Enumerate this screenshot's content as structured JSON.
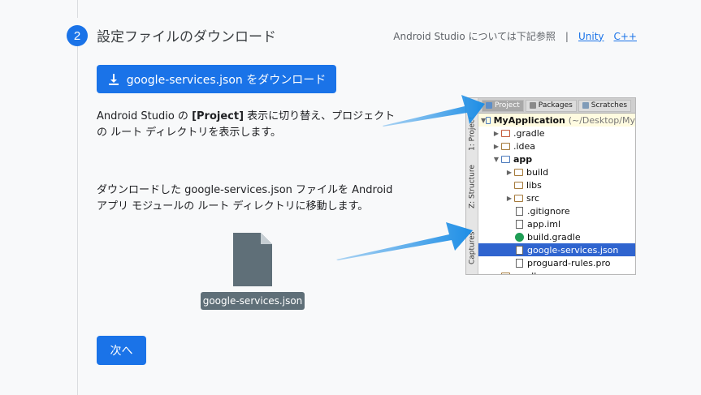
{
  "step": {
    "number": "2",
    "title": "設定ファイルのダウンロード"
  },
  "header_links": {
    "intro_text": "Android Studio については下記参照",
    "separator": "|",
    "unity_label": "Unity",
    "cpp_label": "C++"
  },
  "download_button": {
    "label": "google-services.json をダウンロード",
    "icon": "download-icon"
  },
  "instructions": {
    "first_prefix": "Android Studio の ",
    "first_bold": "[Project]",
    "first_suffix": " 表示に切り替え、プロジェクトの ルート ディレクトリを表示します。",
    "second": "ダウンロードした google-services.json ファイルを Android アプリ モジュールの ルート ディレクトリに移動します。"
  },
  "file_card": {
    "label": "google-services.json",
    "icon": "file-icon",
    "color": "#5f6f78"
  },
  "next_button": {
    "label": "次へ"
  },
  "ide_panel": {
    "side_tabs": [
      "1: Project",
      "Z: Structure",
      "Captures"
    ],
    "tabs": [
      "Project",
      "Packages",
      "Scratches"
    ],
    "root_name": "MyApplication",
    "root_path": "(~/Desktop/My",
    "rows": [
      ".gradle",
      ".idea",
      "app",
      "build",
      "libs",
      "src",
      ".gitignore",
      "app.iml",
      "build.gradle",
      "google-services.json",
      "proguard-rules.pro",
      "gradle"
    ]
  },
  "colors": {
    "accent": "#1a73e8",
    "arrow": "#1d8ee6",
    "selected_row": "#2f64cf"
  }
}
